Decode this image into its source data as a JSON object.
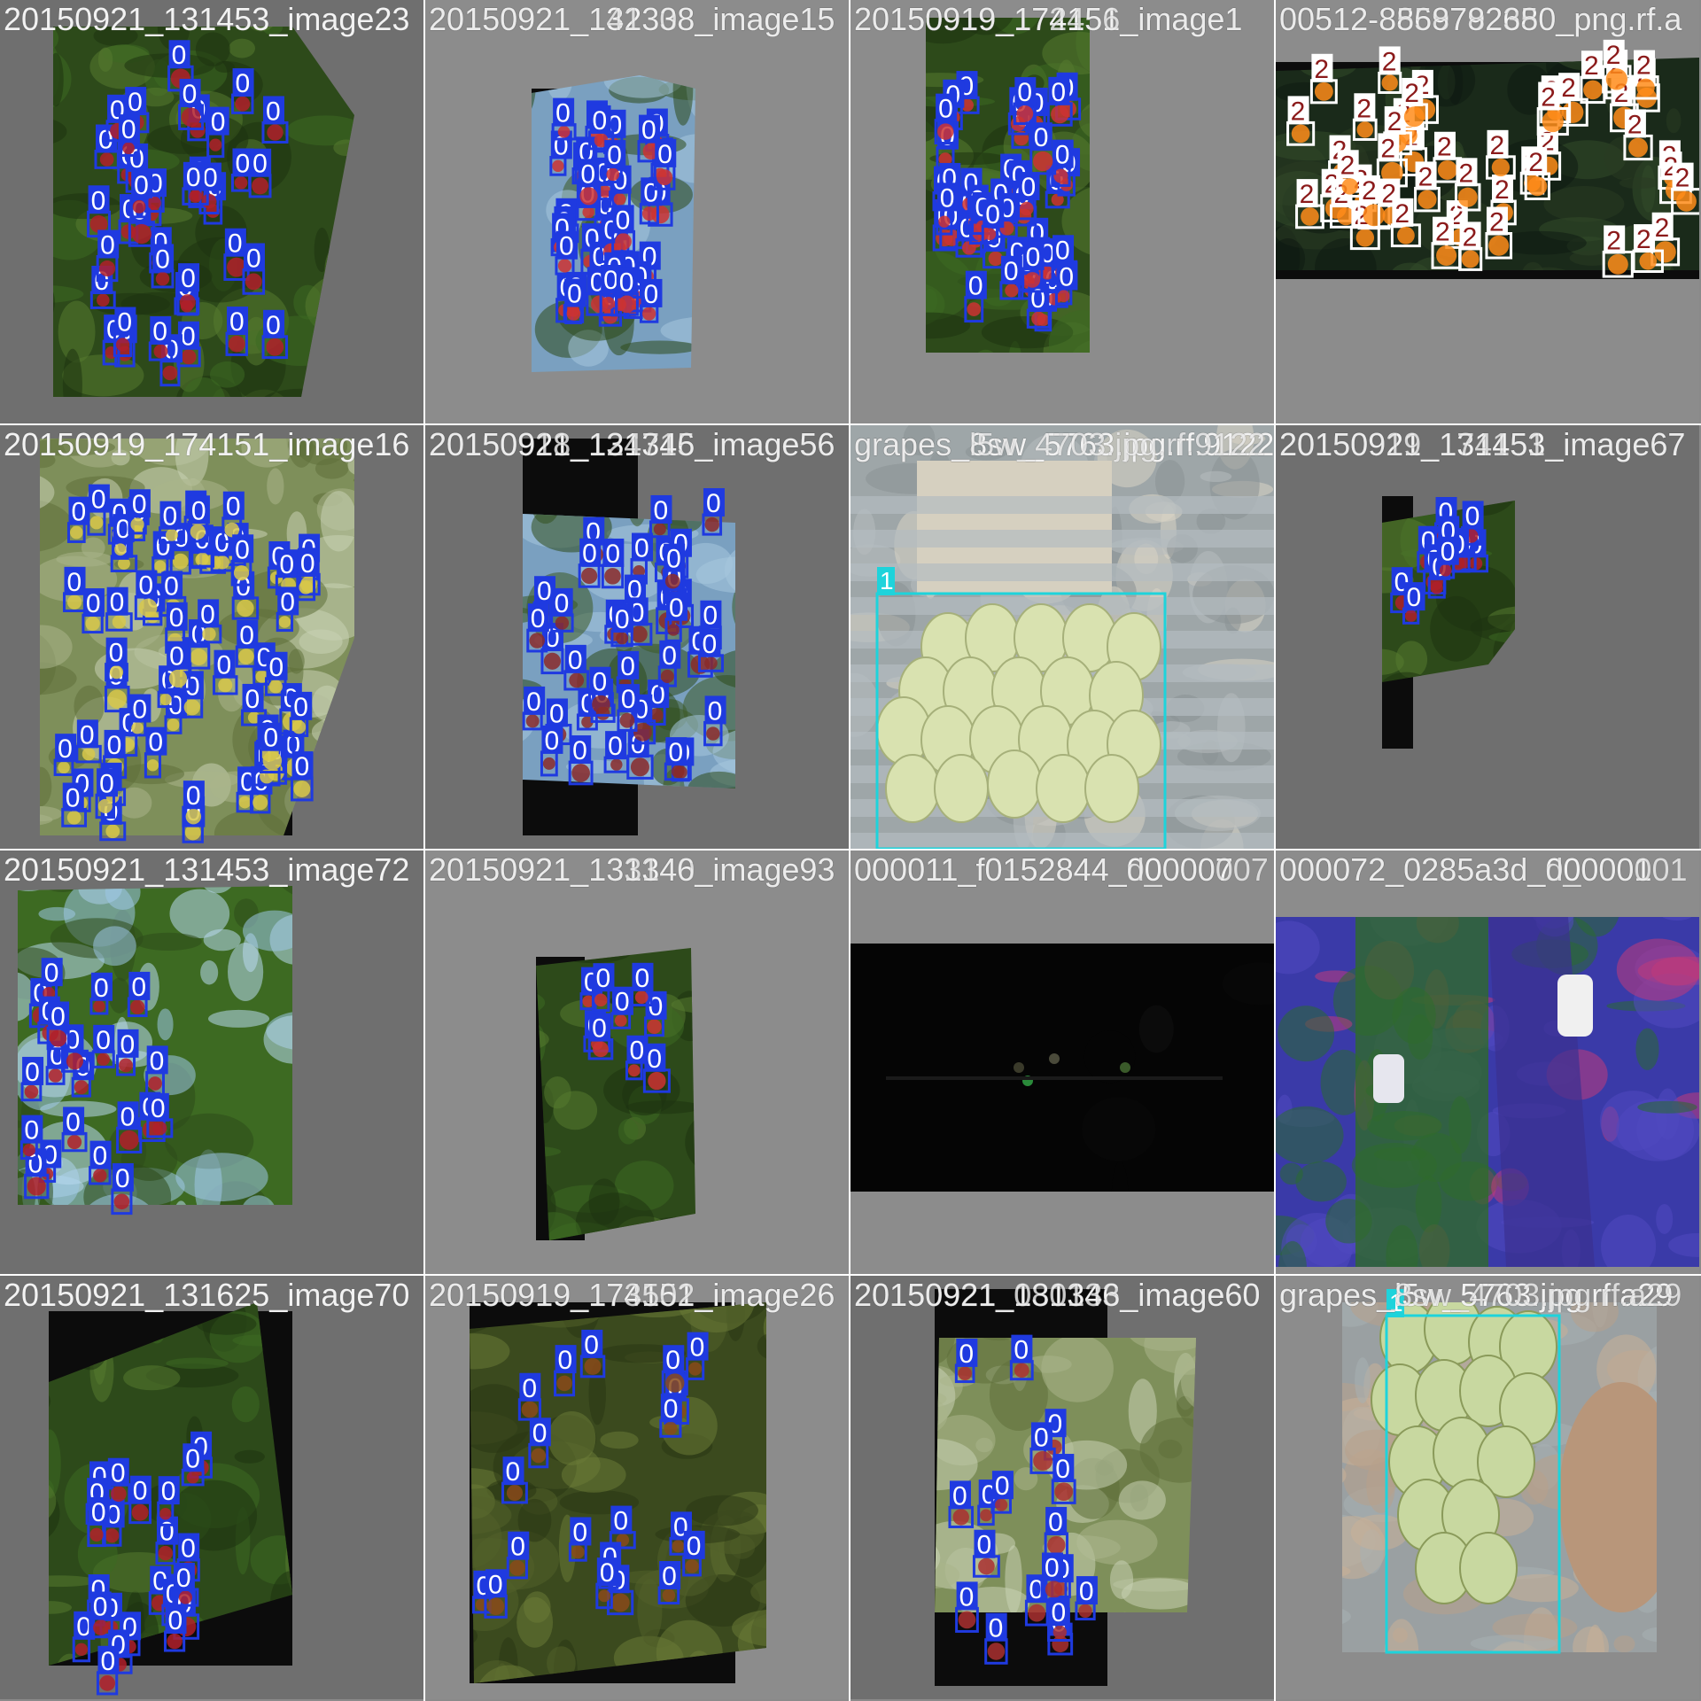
{
  "mosaic": {
    "tiles": [
      {
        "id": "t1",
        "filenames": [
          "20150921_131453_image23"
        ],
        "label_counts": {
          "0": 40
        }
      },
      {
        "id": "t2",
        "filenames": [
          "20150921_132338_image15",
          "20150921_141308_image15"
        ],
        "label_counts": {
          "0": 45
        }
      },
      {
        "id": "t3",
        "filenames": [
          "20150919_174151_image1",
          "20150919_172456_image1"
        ],
        "label_counts": {
          "0": 48
        }
      },
      {
        "id": "t4",
        "filenames": [
          "00512-8869792680_png.rf.a",
          "00512-8558782350_png.rf.a"
        ],
        "label_counts": {
          "2": 48
        }
      },
      {
        "id": "t5",
        "filenames": [
          "20150919_174151_image16"
        ],
        "label_counts": {
          "0": 70
        }
      },
      {
        "id": "t6",
        "filenames": [
          "20150921_131346_image56",
          "20150918_124715_image56"
        ],
        "label_counts": {
          "0": 42
        }
      },
      {
        "id": "t7",
        "filenames": [
          "grapes_8sw_5763.jpg.rf.9122",
          "grapes_l5w_4703.jpg.rf.9122"
        ],
        "label_counts": {
          "1": 1
        }
      },
      {
        "id": "t8",
        "filenames": [
          "20150921_131453_image67",
          "20150919_174151_image67"
        ],
        "label_counts": {
          "0": 12
        }
      },
      {
        "id": "t9",
        "filenames": [
          "20150921_131453_image72"
        ],
        "label_counts": {
          "0": 22
        }
      },
      {
        "id": "t10",
        "filenames": [
          "20150921_131346_image93",
          "20150921_133140_image93"
        ],
        "label_counts": {
          "0": 9
        }
      },
      {
        "id": "t11",
        "filenames": [
          "000011_f0152844_000007",
          "000011_f0152844_d_000007"
        ],
        "label_counts": {}
      },
      {
        "id": "t12",
        "filenames": [
          "000072_0285a3d_000001",
          "000072_0285a3d_d_000001"
        ],
        "label_counts": {}
      },
      {
        "id": "t13",
        "filenames": [
          "20150921_131625_image70"
        ],
        "label_counts": {
          "0": 24
        }
      },
      {
        "id": "t14",
        "filenames": [
          "20150919_174151_image26",
          "20150919_173502_image26"
        ],
        "label_counts": {
          "0": 20
        }
      },
      {
        "id": "t15",
        "filenames": [
          "20150921_131346_image60",
          "20150921_080133_image60"
        ],
        "label_counts": {
          "0": 18
        }
      },
      {
        "id": "t16",
        "filenames": [
          "grapes_l5w_5763.jpg.rf.a29",
          "grapes_8sw_4703.jpg.rf.a29"
        ],
        "label_counts": {
          "1": 1
        }
      }
    ]
  },
  "class_labels": {
    "apple": "0",
    "grape": "1",
    "orange": "2"
  },
  "colors": {
    "class0": "#1f3ae0",
    "class1": "#1ed3db",
    "class2": "#ffffff",
    "class2_text": "#8b1a1a",
    "border": "#ffffff",
    "pad": "#8c8c8c"
  }
}
